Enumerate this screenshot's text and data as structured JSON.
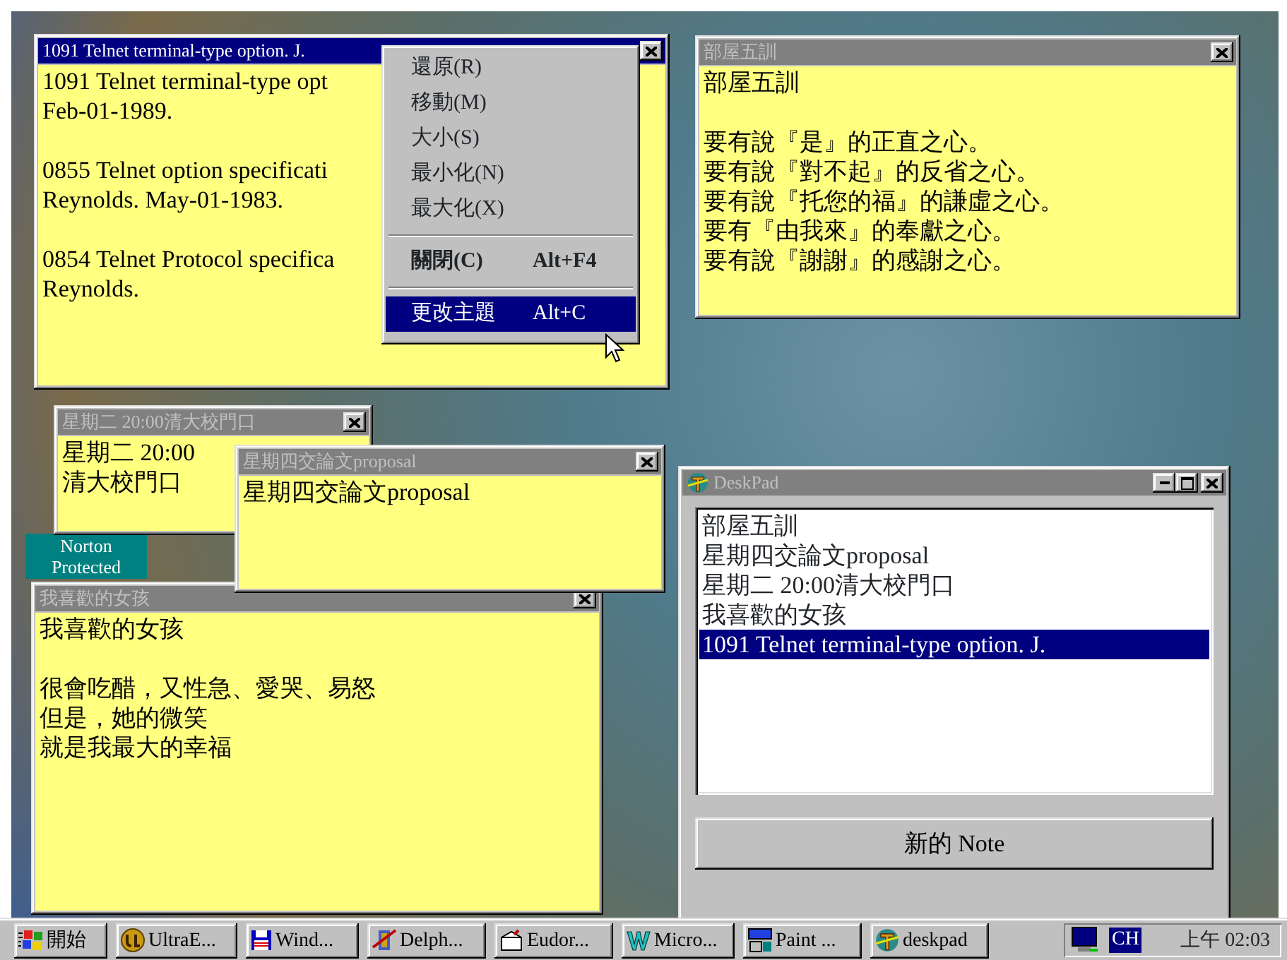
{
  "desktop_icons": [
    {
      "label": "Norton Protected"
    }
  ],
  "notes": [
    {
      "title": "1091 Telnet terminal-type option. J.",
      "active": true,
      "paragraphs": [
        [
          "1091 Telnet terminal-type opt",
          "Feb-01-1989."
        ],
        [
          "0855 Telnet option specificati",
          "Reynolds. May-01-1983."
        ],
        [
          "0854 Telnet Protocol specifica",
          "Reynolds."
        ]
      ]
    },
    {
      "title": "部屋五訓",
      "active": false,
      "paragraphs": [
        [
          "部屋五訓"
        ],
        [
          "要有說『是』的正直之心。",
          "要有說『對不起』的反省之心。",
          "要有說『托您的福』的謙虛之心。",
          "要有『由我來』的奉獻之心。",
          "要有說『謝謝』的感謝之心。"
        ]
      ]
    },
    {
      "title": "星期二 20:00清大校門口",
      "active": false,
      "paragraphs": [
        [
          "星期二 20:00",
          "清大校門口"
        ]
      ]
    },
    {
      "title": "星期四交論文proposal",
      "active": false,
      "paragraphs": [
        [
          "星期四交論文proposal"
        ]
      ]
    },
    {
      "title": "我喜歡的女孩",
      "active": false,
      "paragraphs": [
        [
          "我喜歡的女孩"
        ],
        [
          "很會吃醋，又性急、愛哭、易怒",
          "但是，她的微笑",
          "就是我最大的幸福"
        ]
      ]
    }
  ],
  "context_menu": {
    "items": [
      {
        "kind": "item",
        "label": "還原(R)",
        "default": false,
        "selected": false
      },
      {
        "kind": "item",
        "label": "移動(M)",
        "default": false,
        "selected": false
      },
      {
        "kind": "item",
        "label": "大小(S)",
        "default": false,
        "selected": false
      },
      {
        "kind": "item",
        "label": "最小化(N)",
        "default": false,
        "selected": false
      },
      {
        "kind": "item",
        "label": "最大化(X)",
        "default": false,
        "selected": false
      },
      {
        "kind": "separator"
      },
      {
        "kind": "item",
        "label": "關閉(C)",
        "shortcut": "Alt+F4",
        "default": true,
        "selected": false
      },
      {
        "kind": "separator"
      },
      {
        "kind": "item",
        "label": "更改主題",
        "shortcut": "Alt+C",
        "default": false,
        "selected": true
      }
    ]
  },
  "deskpad": {
    "title": "DeskPad",
    "items": [
      {
        "label": "部屋五訓",
        "selected": false
      },
      {
        "label": "星期四交論文proposal",
        "selected": false
      },
      {
        "label": "星期二 20:00清大校門口",
        "selected": false
      },
      {
        "label": "我喜歡的女孩",
        "selected": false
      },
      {
        "label": "1091 Telnet terminal-type option. J.",
        "selected": true
      }
    ],
    "button": "新的 Note"
  },
  "taskbar": {
    "start": "開始",
    "tasks": [
      {
        "kind": "ue",
        "label": "UltraE..."
      },
      {
        "kind": "disk",
        "label": "Wind..."
      },
      {
        "kind": "delphi",
        "label": "Delph..."
      },
      {
        "kind": "mail",
        "label": "Eudor..."
      },
      {
        "kind": "word",
        "label": "Micro..."
      },
      {
        "kind": "paint",
        "label": "Paint ..."
      },
      {
        "kind": "deskpad",
        "label": "deskpad"
      }
    ],
    "ime": "CH",
    "clock": "上午 02:03"
  }
}
